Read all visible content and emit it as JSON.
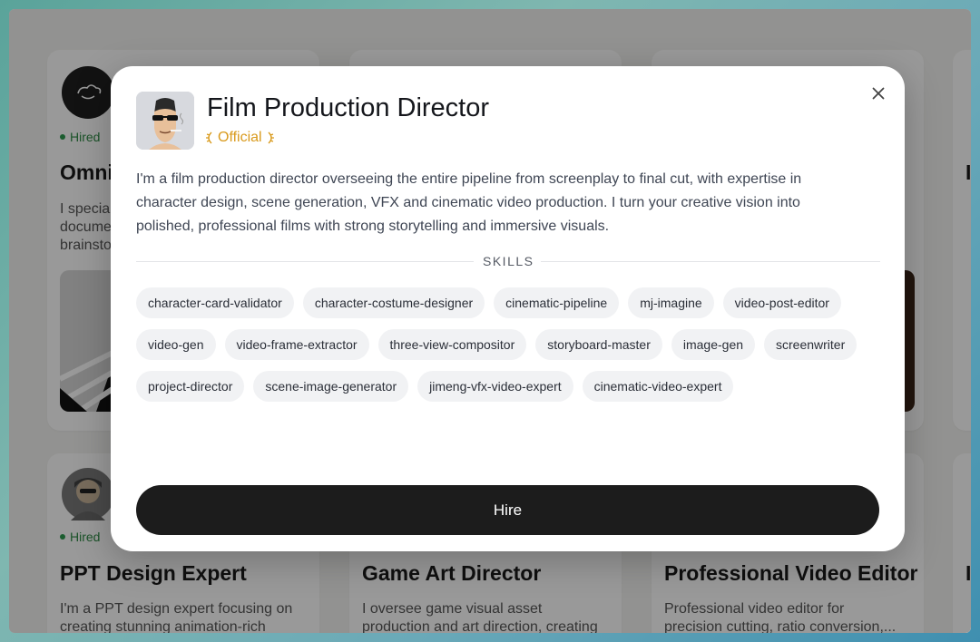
{
  "background_cards": {
    "top_left": {
      "status": "Hired",
      "title": "Omni",
      "desc_lines": [
        "I specia",
        "docume",
        "brainsto"
      ]
    },
    "bottom_left": {
      "status": "Hired",
      "title": "PPT Design Expert",
      "desc_lines": [
        "I'm a PPT design expert focusing on",
        "creating stunning animation-rich"
      ]
    },
    "bottom_mid": {
      "title": "Game Art Director",
      "desc_lines": [
        "I oversee game visual asset",
        "production and art direction, creating"
      ]
    },
    "bottom_right": {
      "title": "Professional Video Editor",
      "desc_lines": [
        "Professional video editor for",
        "precision cutting, ratio conversion,..."
      ]
    },
    "edge_right": {
      "title_fragments": [
        "I",
        "I"
      ]
    }
  },
  "modal": {
    "title": "Film Production Director",
    "badge": "Official",
    "description": "I'm a film production director overseeing the entire pipeline from screenplay to final cut, with expertise in character design, scene generation, VFX and cinematic video production. I turn your creative vision into polished, professional films with strong storytelling and immersive visuals.",
    "skills_heading": "SKILLS",
    "skills": [
      "character-card-validator",
      "character-costume-designer",
      "cinematic-pipeline",
      "mj-imagine",
      "video-post-editor",
      "video-gen",
      "video-frame-extractor",
      "three-view-compositor",
      "storyboard-master",
      "image-gen",
      "screenwriter",
      "project-director",
      "scene-image-generator",
      "jimeng-vfx-video-expert",
      "cinematic-video-expert"
    ],
    "hire_label": "Hire"
  },
  "colors": {
    "accent_gold": "#d99a1c",
    "hired_green": "#2e9a4f",
    "button_dark": "#1c1c1c"
  }
}
